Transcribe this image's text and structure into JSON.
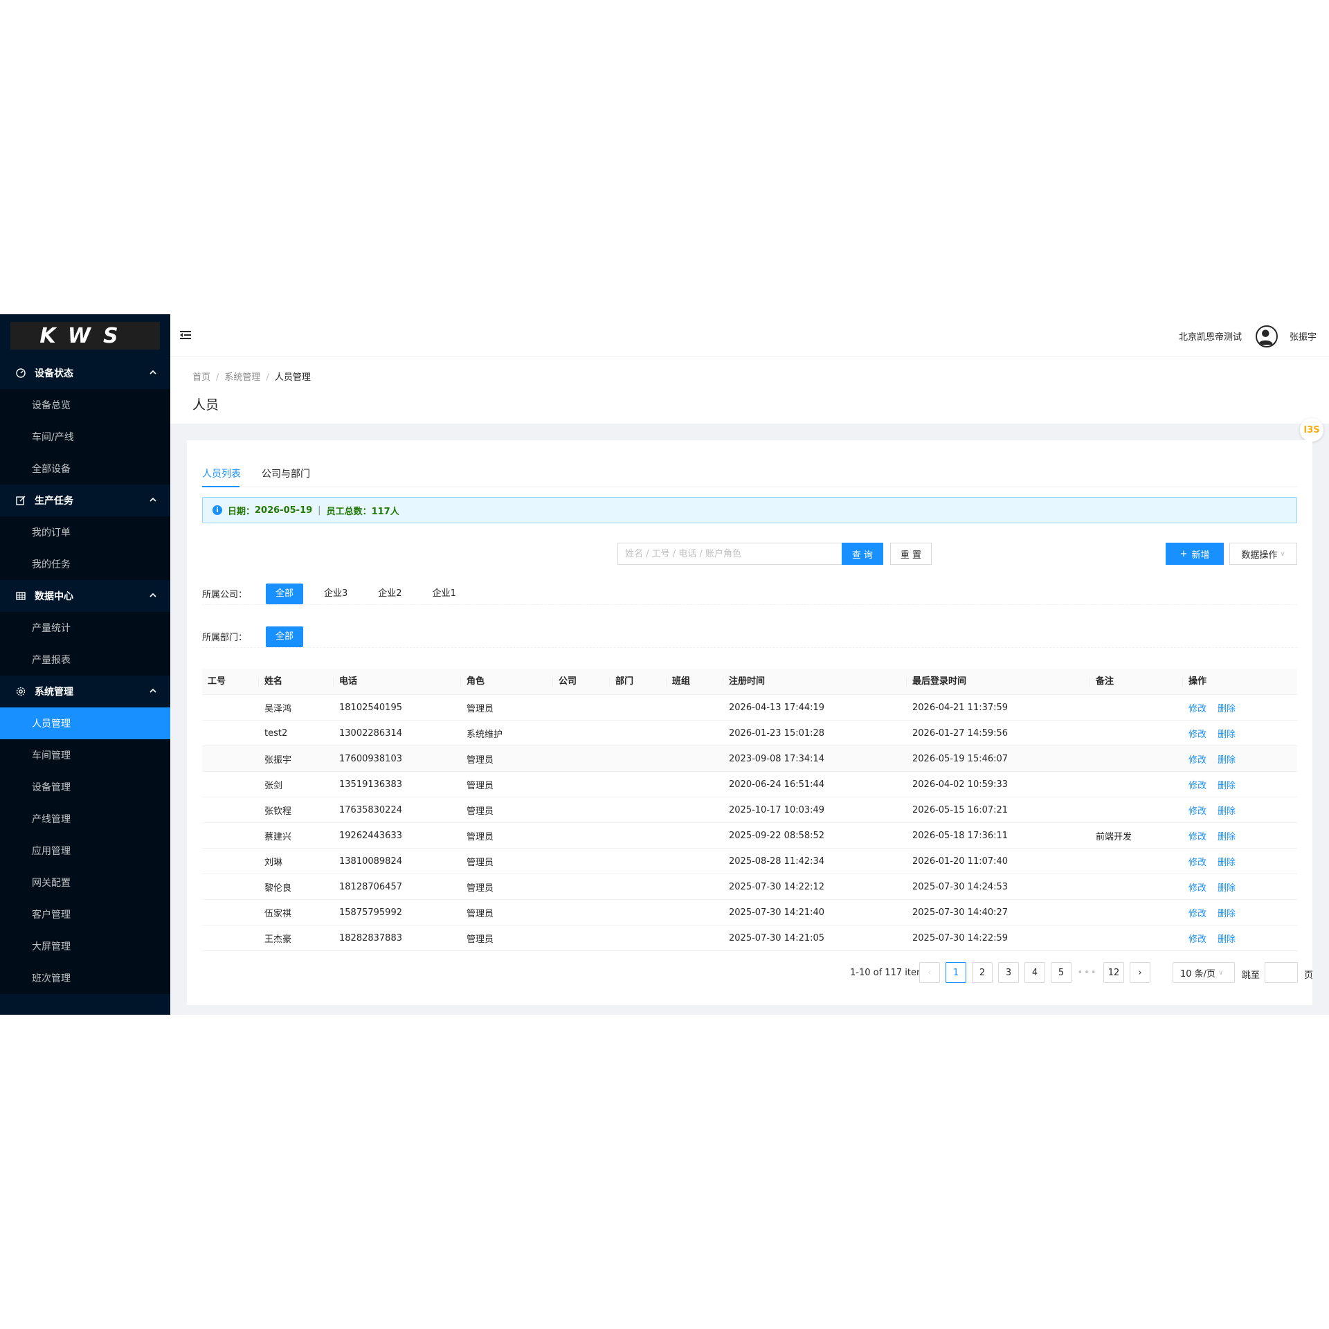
{
  "brand": {
    "logo_text": "KWS"
  },
  "sidebar": {
    "groups": [
      {
        "title": "设备状态",
        "icon": "dashboard-icon",
        "items": [
          "设备总览",
          "车间/产线",
          "全部设备"
        ]
      },
      {
        "title": "生产任务",
        "icon": "edit-icon",
        "items": [
          "我的订单",
          "我的任务"
        ]
      },
      {
        "title": "数据中心",
        "icon": "table-icon",
        "items": [
          "产量统计",
          "产量报表"
        ]
      },
      {
        "title": "系统管理",
        "icon": "gear-icon",
        "items": [
          "人员管理",
          "车间管理",
          "设备管理",
          "产线管理",
          "应用管理",
          "网关配置",
          "客户管理",
          "大屏管理",
          "班次管理"
        ]
      }
    ],
    "active_item": "人员管理"
  },
  "header": {
    "company": "北京凯恩帝测试",
    "user": "张振宇"
  },
  "breadcrumb": {
    "items": [
      "首页",
      "系统管理",
      "人员管理"
    ]
  },
  "page": {
    "title": "人员"
  },
  "tabs": {
    "list": "人员列表",
    "company": "公司与部门",
    "active": "人员列表"
  },
  "alert": {
    "date_label": "日期：",
    "date": "2026-05-19",
    "sep": "|",
    "total_label": "员工总数：",
    "total": "117人"
  },
  "search": {
    "placeholder": "姓名 / 工号 / 电话 / 账户角色",
    "value": "",
    "query_label": "查 询",
    "reset_label": "重 置"
  },
  "actions": {
    "add_label": "新增",
    "data_label": "数据操作"
  },
  "filters": {
    "company": {
      "label": "所属公司：",
      "options": [
        "全部",
        "企业3",
        "企业2",
        "企业1"
      ],
      "selected": "全部"
    },
    "department": {
      "label": "所属部门：",
      "options": [
        "全部"
      ],
      "selected": "全部"
    }
  },
  "table": {
    "columns": [
      "工号",
      "姓名",
      "电话",
      "角色",
      "公司",
      "部门",
      "班组",
      "注册时间",
      "最后登录时间",
      "备注",
      "操作"
    ],
    "rows": [
      [
        "",
        "吴泽鸿",
        "18102540195",
        "管理员",
        "",
        "",
        "",
        "2026-04-13 17:44:19",
        "2026-04-21 11:37:59",
        ""
      ],
      [
        "",
        "test2",
        "13002286314",
        "系统维护",
        "",
        "",
        "",
        "2026-01-23 15:01:28",
        "2026-01-27 14:59:56",
        ""
      ],
      [
        "",
        "张振宇",
        "17600938103",
        "管理员",
        "",
        "",
        "",
        "2023-09-08 17:34:14",
        "2026-05-19 15:46:07",
        ""
      ],
      [
        "",
        "张剑",
        "13519136383",
        "管理员",
        "",
        "",
        "",
        "2020-06-24 16:51:44",
        "2026-04-02 10:59:33",
        ""
      ],
      [
        "",
        "张钦程",
        "17635830224",
        "管理员",
        "",
        "",
        "",
        "2025-10-17 10:03:49",
        "2026-05-15 16:07:21",
        ""
      ],
      [
        "",
        "蔡建兴",
        "19262443633",
        "管理员",
        "",
        "",
        "",
        "2025-09-22 08:58:52",
        "2026-05-18 17:36:11",
        "前端开发"
      ],
      [
        "",
        "刘琳",
        "13810089824",
        "管理员",
        "",
        "",
        "",
        "2025-08-28 11:42:34",
        "2026-01-20 11:07:40",
        ""
      ],
      [
        "",
        "黎伦良",
        "18128706457",
        "管理员",
        "",
        "",
        "",
        "2025-07-30 14:22:12",
        "2025-07-30 14:24:53",
        ""
      ],
      [
        "",
        "伍家祺",
        "15875795992",
        "管理员",
        "",
        "",
        "",
        "2025-07-30 14:21:40",
        "2025-07-30 14:40:27",
        ""
      ],
      [
        "",
        "王杰豪",
        "18282837883",
        "管理员",
        "",
        "",
        "",
        "2025-07-30 14:21:05",
        "2025-07-30 14:22:59",
        ""
      ]
    ],
    "edit_label": "修改",
    "delete_label": "删除"
  },
  "pagination": {
    "total_text": "1-10 of 117 items",
    "pages": [
      "1",
      "2",
      "3",
      "4",
      "5",
      "•••",
      "12"
    ],
    "current": "1",
    "page_size": "10 条/页",
    "jump_label": "跳至",
    "page_suffix": "页"
  },
  "float_badge": "I3S",
  "colors": {
    "primary": "#1890ff",
    "sidebar_bg": "#001529",
    "alert_text": "#237804"
  }
}
